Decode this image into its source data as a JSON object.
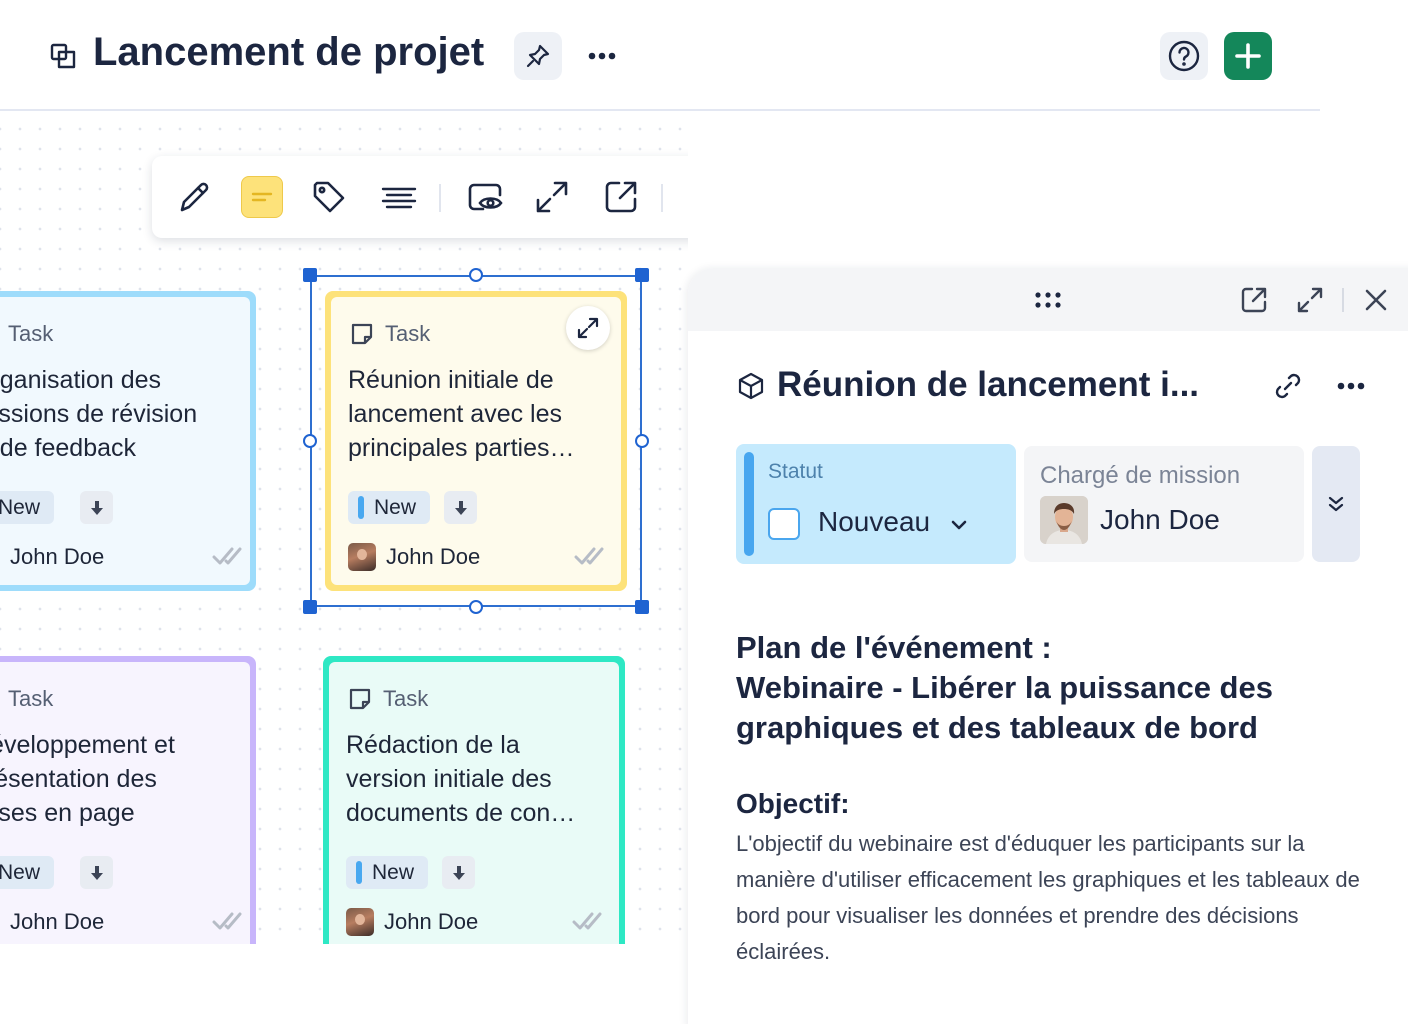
{
  "header": {
    "title": "Lancement de projet",
    "pin_icon": "pin-icon",
    "more_icon": "more-horizontal-icon",
    "help_icon": "help-circle-icon",
    "add_icon": "plus-icon"
  },
  "toolbar": {
    "items": [
      "edit-pencil-icon",
      "sticky-note-icon",
      "tag-icon",
      "align-text-icon",
      "view-eye-icon",
      "expand-icon",
      "open-external-icon",
      "ai-sparkle-icon",
      "more-vertical-icon"
    ]
  },
  "cards": [
    {
      "type": "Task",
      "title": "Organisation des\nsessions de révision\net de feedback",
      "status": "New",
      "assignee": "John Doe",
      "color": "#9edcfb"
    },
    {
      "type": "Task",
      "title": "Réunion initiale de\nlancement avec les\nprincipales parties…",
      "status": "New",
      "assignee": "John Doe",
      "color": "#fde27a"
    },
    {
      "type": "Task",
      "title": "Développement et\nprésentation des\nmises en page",
      "status": "New",
      "assignee": "John Doe",
      "color": "#c8b5fb"
    },
    {
      "type": "Task",
      "title": "Rédaction de la\nversion initiale des\ndocuments de con…",
      "status": "New",
      "assignee": "John Doe",
      "color": "#2ee8c4"
    }
  ],
  "panel": {
    "title": "Réunion de lancement i...",
    "status_label": "Statut",
    "status_value": "Nouveau",
    "assignee_label": "Chargé de mission",
    "assignee_name": "John Doe",
    "heading_line1": "Plan de l'événement :",
    "heading_line2": "Webinaire - Libérer la puissance des graphiques et des tableaux de bord",
    "objective_heading": "Objectif:",
    "objective_text": "L'objectif du webinaire est d'éduquer les participants sur la manière d'utiliser efficacement les graphiques et les tableaux de bord pour visualiser les données et prendre des décisions éclairées."
  },
  "colors": {
    "accent_green": "#14875a",
    "selection_blue": "#1f63d1",
    "status_blue": "#47a6ef"
  }
}
